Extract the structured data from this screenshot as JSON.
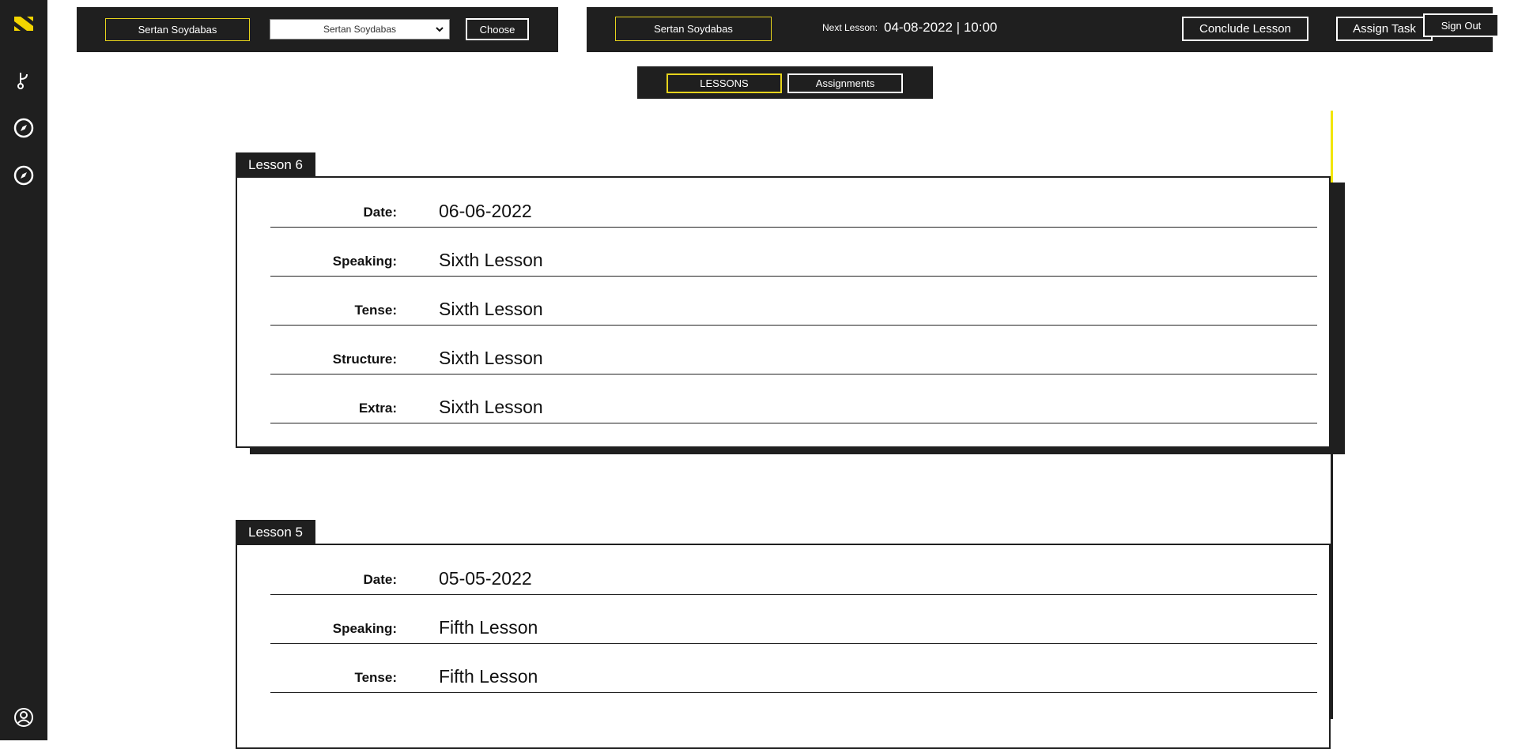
{
  "sidebar": {
    "items": [
      {
        "name": "logo-icon"
      },
      {
        "name": "branch-icon"
      },
      {
        "name": "compass-icon"
      },
      {
        "name": "compass-icon"
      },
      {
        "name": "user-icon"
      }
    ]
  },
  "top_left": {
    "student_name": "Sertan Soydabas",
    "select_value": "Sertan Soydabas",
    "choose_label": "Choose"
  },
  "top_right": {
    "student_name": "Sertan Soydabas",
    "next_lesson_label": "Next Lesson:",
    "next_lesson_value": "04-08-2022 | 10:00",
    "conclude_label": "Conclude Lesson",
    "assign_label": "Assign Task",
    "signout_label": "Sign Out"
  },
  "tabs": {
    "lessons": "LESSONS",
    "assignments": "Assignments"
  },
  "lessons": [
    {
      "title": "Lesson 6",
      "fields": [
        {
          "label": "Date:",
          "value": "06-06-2022"
        },
        {
          "label": "Speaking:",
          "value": "Sixth Lesson"
        },
        {
          "label": "Tense:",
          "value": "Sixth Lesson"
        },
        {
          "label": "Structure:",
          "value": "Sixth Lesson"
        },
        {
          "label": "Extra:",
          "value": "Sixth Lesson"
        }
      ]
    },
    {
      "title": "Lesson 5",
      "fields": [
        {
          "label": "Date:",
          "value": "05-05-2022"
        },
        {
          "label": "Speaking:",
          "value": "Fifth Lesson"
        },
        {
          "label": "Tense:",
          "value": "Fifth Lesson"
        }
      ]
    }
  ],
  "colors": {
    "dark": "#1f1f1f",
    "accent": "#e6d31c",
    "scroll_thumb": "#f2e500"
  }
}
